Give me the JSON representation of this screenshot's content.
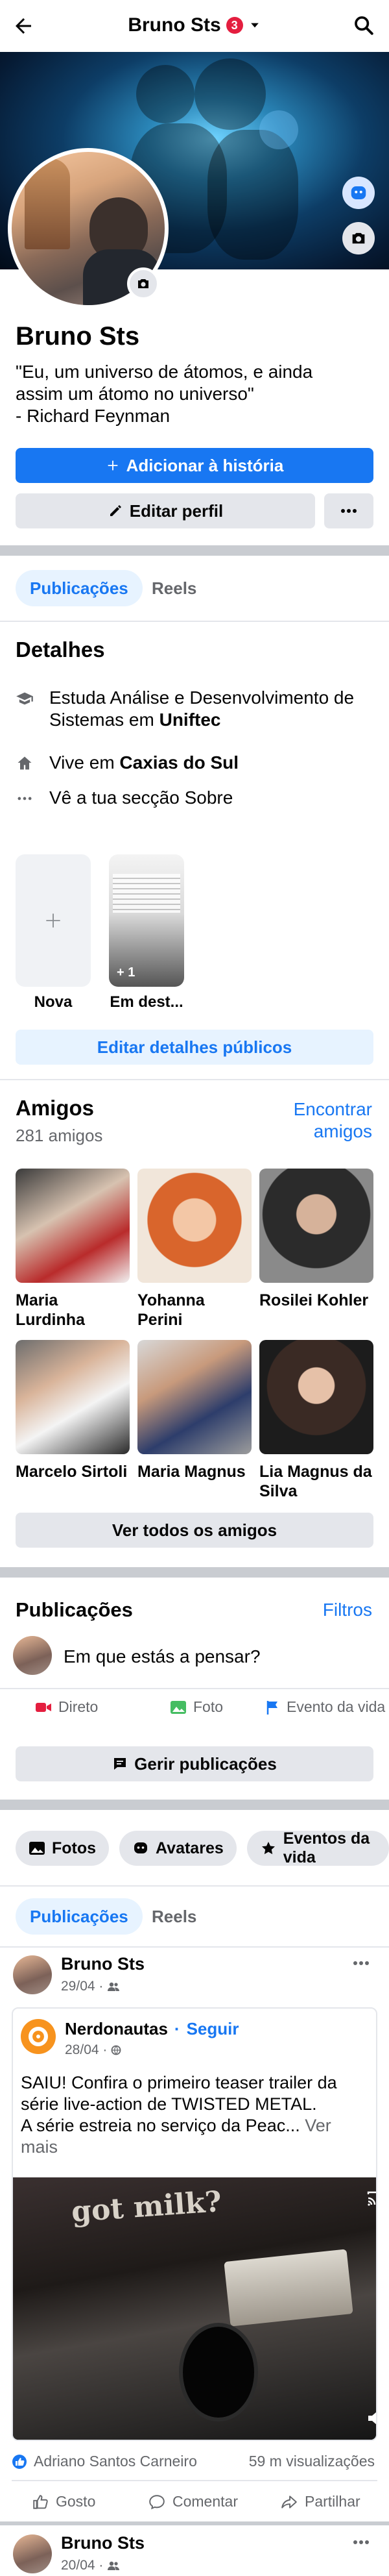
{
  "header": {
    "title": "Bruno Sts",
    "badge": "3"
  },
  "profile": {
    "name": "Bruno Sts",
    "bio": "\"Eu, um universo de átomos, e ainda\nassim um átomo no universo\"\n- Richard Feynman"
  },
  "actions": {
    "add_story": "Adicionar à história",
    "edit_profile": "Editar perfil"
  },
  "tabs": [
    {
      "label": "Publicações"
    },
    {
      "label": "Reels"
    }
  ],
  "details": {
    "title": "Detalhes",
    "study_prefix": "Estuda Análise e Desenvolvimento de Sistemas em ",
    "study_place": "Uniftec",
    "lives_prefix": "Vive em ",
    "lives_place": "Caxias do Sul",
    "about": "Vê a tua secção Sobre"
  },
  "stories": {
    "new_label": "Nova",
    "featured_label": "Em dest...",
    "featured_count": "+ 1"
  },
  "edit_public": "Editar detalhes públicos",
  "friends": {
    "title": "Amigos",
    "count": "281 amigos",
    "find": "Encontrar\namigos",
    "list": [
      {
        "name": "Maria\nLurdinha"
      },
      {
        "name": "Yohanna\nPerini"
      },
      {
        "name": "Rosilei Kohler"
      },
      {
        "name": "Marcelo Sirtoli"
      },
      {
        "name": "Maria Magnus"
      },
      {
        "name": "Lia Magnus da\nSilva"
      }
    ],
    "see_all": "Ver todos os amigos"
  },
  "posts_section": {
    "title": "Publicações",
    "filters": "Filtros",
    "composer_placeholder": "Em que estás a pensar?",
    "live": "Direto",
    "photo": "Foto",
    "life_event": "Evento da vida",
    "manage": "Gerir publicações"
  },
  "chips": [
    {
      "label": "Fotos"
    },
    {
      "label": "Avatares"
    },
    {
      "label": "Eventos da vida"
    }
  ],
  "post1": {
    "author": "Bruno Sts",
    "date": "29/04 ·",
    "shared_page": "Nerdonautas",
    "follow": "Seguir",
    "shared_date": "28/04 ·",
    "text": "SAIU! Confira o primeiro teaser trailer da série live-action de TWISTED METAL.\nA série estreia no serviço da Peac... ",
    "see_more": "Ver mais",
    "video_text": "got milk?",
    "reactor": "Adriano Santos Carneiro",
    "views": "59 m visualizações",
    "like": "Gosto",
    "comment": "Comentar",
    "share": "Partilhar"
  },
  "post2": {
    "author": "Bruno Sts",
    "date": "20/04 ·"
  },
  "colors": {
    "accent": "#1877f2",
    "badge": "#e41e3f",
    "separator": "#c9ccd1"
  }
}
